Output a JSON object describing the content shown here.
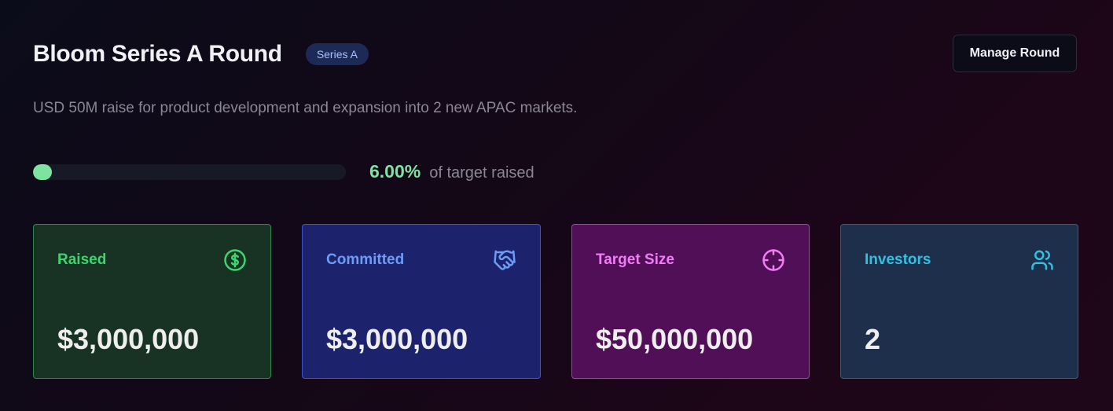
{
  "header": {
    "title": "Bloom Series A Round",
    "badge": "Series A",
    "manage_label": "Manage Round"
  },
  "description": "USD 50M raise for product development and expansion into 2 new APAC markets.",
  "progress": {
    "percent_value": 6.0,
    "percent_text": "6.00%",
    "label": "of target raised",
    "color": "#7ee3a1"
  },
  "cards": [
    {
      "label": "Raised",
      "value": "$3,000,000",
      "icon": "dollar-circle-icon",
      "accent": "#3dd56e"
    },
    {
      "label": "Committed",
      "value": "$3,000,000",
      "icon": "handshake-icon",
      "accent": "#6d9cf6"
    },
    {
      "label": "Target Size",
      "value": "$50,000,000",
      "icon": "crosshair-icon",
      "accent": "#f07df5"
    },
    {
      "label": "Investors",
      "value": "2",
      "icon": "users-icon",
      "accent": "#32c0e2"
    }
  ]
}
